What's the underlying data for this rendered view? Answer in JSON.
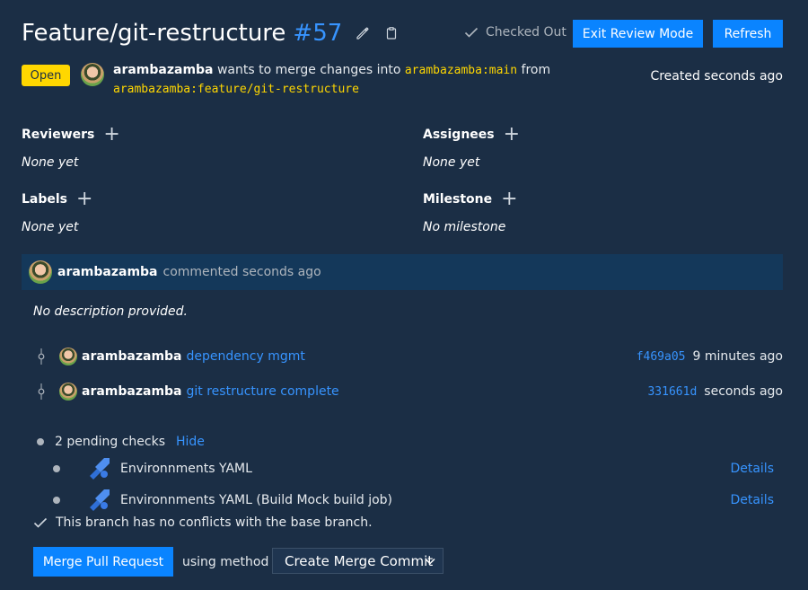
{
  "header": {
    "title": "Feature/git-restructure",
    "number": "#57",
    "checked_out": "Checked Out",
    "exit_label": "Exit Review Mode",
    "refresh_label": "Refresh"
  },
  "status": {
    "badge": "Open",
    "author": "arambazamba",
    "merge_text": "wants to merge changes into",
    "target_branch": "arambazamba:main",
    "from_text": "from",
    "source_branch": "arambazamba:feature/git-restructure",
    "created": "Created seconds ago"
  },
  "meta": {
    "reviewers": {
      "label": "Reviewers",
      "value": "None yet"
    },
    "assignees": {
      "label": "Assignees",
      "value": "None yet"
    },
    "labels": {
      "label": "Labels",
      "value": "None yet"
    },
    "milestone": {
      "label": "Milestone",
      "value": "No milestone"
    }
  },
  "comment": {
    "author": "arambazamba",
    "action": "commented seconds ago",
    "body": "No description provided."
  },
  "commits": [
    {
      "author": "arambazamba",
      "message": "dependency mgmt",
      "sha": "f469a05",
      "time": "9 minutes ago"
    },
    {
      "author": "arambazamba",
      "message": "git restructure complete",
      "sha": "331661d",
      "time": "seconds ago"
    }
  ],
  "checks": {
    "summary": "2 pending checks",
    "hide_label": "Hide",
    "items": [
      {
        "name": "Environnments YAML",
        "details": "Details"
      },
      {
        "name": "Environnments YAML (Build Mock build job)",
        "details": "Details"
      }
    ],
    "no_conflicts": "This branch has no conflicts with the base branch."
  },
  "merge": {
    "button_label": "Merge Pull Request",
    "using_method": "using method",
    "method": "Create Merge Commit"
  },
  "colors": {
    "background": "#1b2e45",
    "accent": "#0a84ff",
    "link": "#3794ff",
    "badge": "#ffd700",
    "comment_header": "#14385a"
  }
}
